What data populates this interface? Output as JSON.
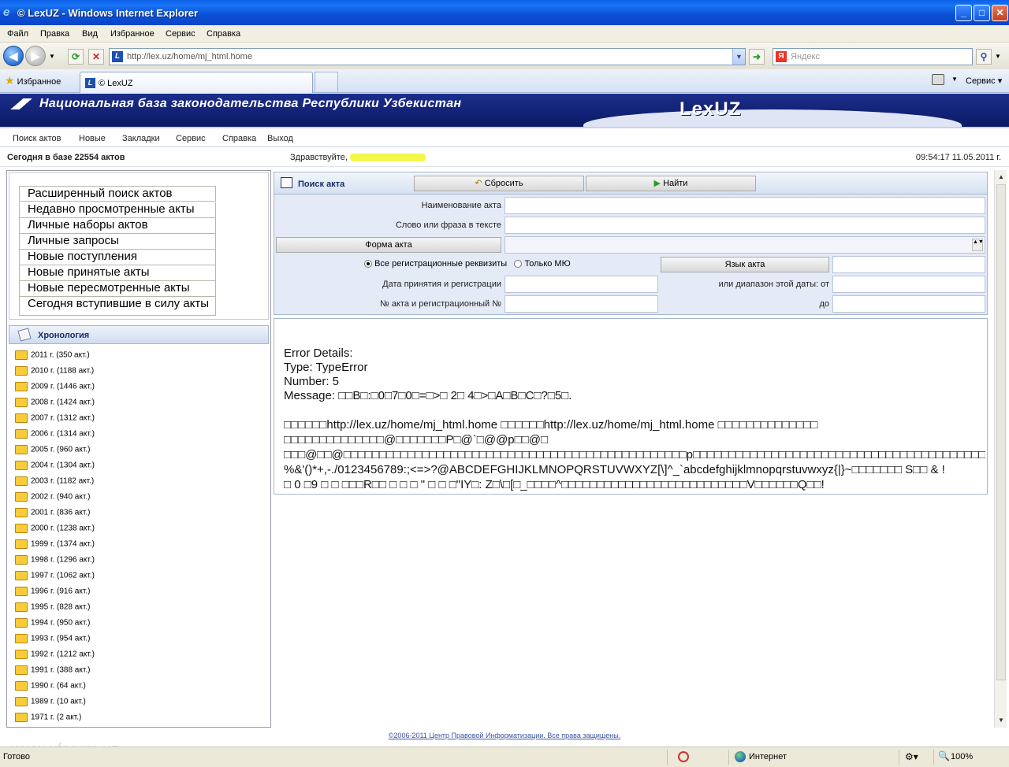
{
  "window": {
    "title": "© LexUZ - Windows Internet Explorer",
    "minimize": "_",
    "maximize": "□",
    "close": "✕"
  },
  "menu": [
    "Файл",
    "Правка",
    "Вид",
    "Избранное",
    "Сервис",
    "Справка"
  ],
  "address": {
    "url": "http://lex.uz/home/mj_html.home",
    "search_placeholder": "Яндекс"
  },
  "tabs": {
    "favorites_label": "Избранное",
    "active_tab": "© LexUZ",
    "tools_label": "Сервис"
  },
  "banner": {
    "title": "Национальная база законодательства Республики Узбекистан",
    "logo_text": "LexUZ"
  },
  "site_nav": [
    "Поиск актов",
    "Новые",
    "Закладки",
    "Сервис",
    "Справка",
    "Выход"
  ],
  "info": {
    "count_text": "Сегодня в базе 22554 актов",
    "greeting": "Здравствуйте,",
    "datetime": "09:54:17  11.05.2011 г."
  },
  "left_menu": [
    "Расширенный поиск актов",
    "Недавно просмотренные акты",
    "Личные наборы актов",
    "Личные запросы",
    "Новые поступления",
    "Новые принятые акты",
    "Новые пересмотренные акты",
    "Сегодня вступившие в силу акты"
  ],
  "chronology": {
    "title": "Хронология",
    "years": [
      "2011 г. (350 акт.)",
      "2010 г. (1188 акт.)",
      "2009 г. (1446 акт.)",
      "2008 г. (1424 акт.)",
      "2007 г. (1312 акт.)",
      "2006 г. (1314 акт.)",
      "2005 г. (960 акт.)",
      "2004 г. (1304 акт.)",
      "2003 г. (1182 акт.)",
      "2002 г. (940 акт.)",
      "2001 г. (836 акт.)",
      "2000 г. (1238 акт.)",
      "1999 г. (1374 акт.)",
      "1998 г. (1296 акт.)",
      "1997 г. (1062 акт.)",
      "1996 г. (916 акт.)",
      "1995 г. (828 акт.)",
      "1994 г. (950 акт.)",
      "1993 г. (954 акт.)",
      "1992 г. (1212 акт.)",
      "1991 г. (388 акт.)",
      "1990 г. (64 акт.)",
      "1989 г. (10 акт.)",
      "1971 г. (2 акт.)"
    ]
  },
  "search_form": {
    "title": "Поиск акта",
    "reset_label": "Сбросить",
    "find_label": "Найти",
    "name_label": "Наименование акта",
    "phrase_label": "Слово или фраза в тексте",
    "form_label": "Форма акта",
    "radio_all": "Все регистрационные реквизиты",
    "radio_mju": "Только МЮ",
    "language_label": "Язык акта",
    "date_label": "Дата принятия и регистрации",
    "range_label": "или диапазон этой даты:  от",
    "number_label": "№ акта и регистрационный №",
    "to_label": "до"
  },
  "error": {
    "lines": [
      "Error Details:",
      " Type: TypeError",
      " Number: 5",
      " Message: □□B□:□0□7□0□=□>□ 2□ 4□>□A□B□C□?□5□.",
      "",
      "□□□□□□http://lex.uz/home/mj_html.home □□□□□□http://lex.uz/home/mj_html.home □□□□□□□□□□□□□□",
      "□□□□□□□□□□□□□□@□□□□□□□P□@`□@@p□□@□",
      "□□□@□□@□□□□□□□□□□□□□□□□□□□□□□□□□□□□□□□□□□□□□□□□□□□□□□□□p□□□□□□□□□□□□□□□□□□□□□□□□□□□□□□□□□□□□□□□□□□□□",
      "%&'()*+,-./0123456789:;<=>?@ABCDEFGHIJKLMNOPQRSTUVWXYZ[\\]^_`abcdefghijklmnopqrstuvwxyz{|}~□□□□□□□ S□□ & !",
      "□ 0 □9 □ □ □□□R□□ □ □ □ \" □ □ □\"IY□: Z□\\□[□_□□□□^□□□□□□□□□□□□□□□□□□□□□□□□□□V□□□□□□Q□□!"
    ]
  },
  "footer": "©2006-2011 Центр Правовой Информатизации. Все права защищены.",
  "status": {
    "ready": "Готово",
    "zone": "Интернет",
    "zoom": "100%",
    "watermark": "www.uforum.uz"
  }
}
